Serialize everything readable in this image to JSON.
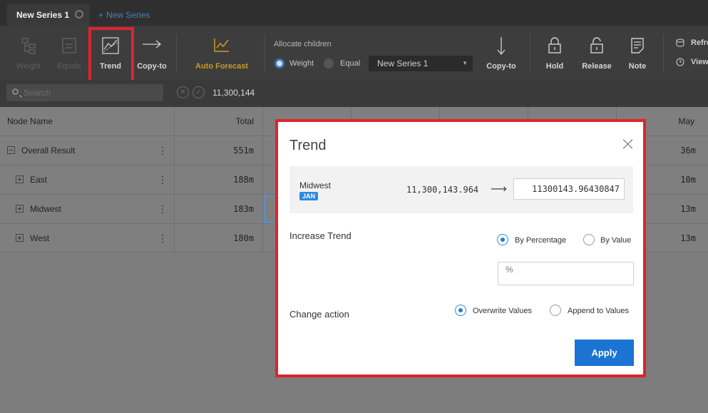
{
  "tabs": {
    "active": "New Series 1",
    "new": "New Series"
  },
  "toolbar": {
    "weight": "Weight",
    "equals": "Equals",
    "trend": "Trend",
    "copy_to_1": "Copy-to",
    "auto_forecast": "Auto Forecast",
    "allocate_title": "Allocate children",
    "alloc_weight": "Weight",
    "alloc_equal": "Equal",
    "series_select": "New Series 1",
    "copy_to_2": "Copy-to",
    "hold": "Hold",
    "release": "Release",
    "note": "Note",
    "refresh": "Refre",
    "view": "View"
  },
  "search": {
    "placeholder": "Search",
    "formula_value": "11,300,144"
  },
  "grid": {
    "headers": {
      "node_name": "Node Name",
      "total": "Total",
      "may": "May"
    },
    "rows": [
      {
        "name": "Overall Result",
        "total": "551m",
        "may": "36m"
      },
      {
        "name": "East",
        "total": "188m",
        "may": "10m"
      },
      {
        "name": "Midwest",
        "total": "183m",
        "may": "13m"
      },
      {
        "name": "West",
        "total": "180m",
        "may": "13m"
      }
    ]
  },
  "dialog": {
    "title": "Trend",
    "node": "Midwest",
    "period_badge": "JAN",
    "from_value": "11,300,143.964",
    "to_value": "11300143.96430847",
    "increase_label": "Increase Trend",
    "by_percentage": "By Percentage",
    "by_value": "By Value",
    "pct_placeholder": "%",
    "change_label": "Change action",
    "overwrite": "Overwrite Values",
    "append": "Append to Values",
    "apply": "Apply"
  }
}
